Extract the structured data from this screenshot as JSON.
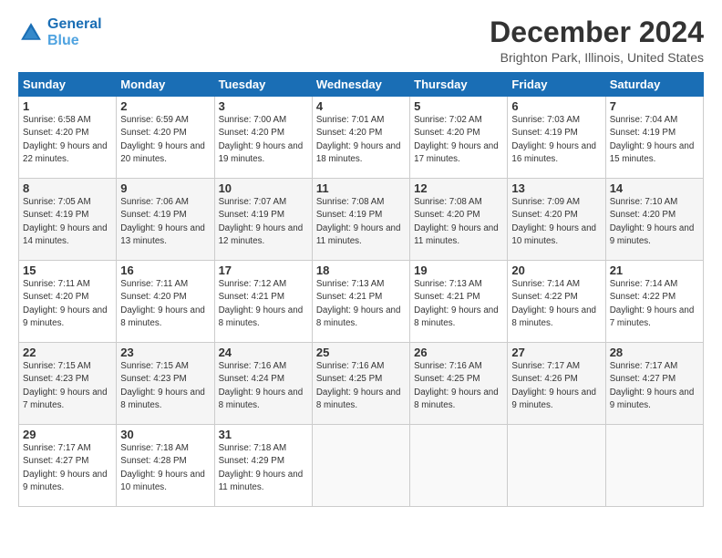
{
  "logo": {
    "line1": "General",
    "line2": "Blue"
  },
  "title": "December 2024",
  "subtitle": "Brighton Park, Illinois, United States",
  "days_header": [
    "Sunday",
    "Monday",
    "Tuesday",
    "Wednesday",
    "Thursday",
    "Friday",
    "Saturday"
  ],
  "weeks": [
    [
      {
        "day": "1",
        "sunrise": "6:58 AM",
        "sunset": "4:20 PM",
        "daylight": "9 hours and 22 minutes."
      },
      {
        "day": "2",
        "sunrise": "6:59 AM",
        "sunset": "4:20 PM",
        "daylight": "9 hours and 20 minutes."
      },
      {
        "day": "3",
        "sunrise": "7:00 AM",
        "sunset": "4:20 PM",
        "daylight": "9 hours and 19 minutes."
      },
      {
        "day": "4",
        "sunrise": "7:01 AM",
        "sunset": "4:20 PM",
        "daylight": "9 hours and 18 minutes."
      },
      {
        "day": "5",
        "sunrise": "7:02 AM",
        "sunset": "4:20 PM",
        "daylight": "9 hours and 17 minutes."
      },
      {
        "day": "6",
        "sunrise": "7:03 AM",
        "sunset": "4:19 PM",
        "daylight": "9 hours and 16 minutes."
      },
      {
        "day": "7",
        "sunrise": "7:04 AM",
        "sunset": "4:19 PM",
        "daylight": "9 hours and 15 minutes."
      }
    ],
    [
      {
        "day": "8",
        "sunrise": "7:05 AM",
        "sunset": "4:19 PM",
        "daylight": "9 hours and 14 minutes."
      },
      {
        "day": "9",
        "sunrise": "7:06 AM",
        "sunset": "4:19 PM",
        "daylight": "9 hours and 13 minutes."
      },
      {
        "day": "10",
        "sunrise": "7:07 AM",
        "sunset": "4:19 PM",
        "daylight": "9 hours and 12 minutes."
      },
      {
        "day": "11",
        "sunrise": "7:08 AM",
        "sunset": "4:19 PM",
        "daylight": "9 hours and 11 minutes."
      },
      {
        "day": "12",
        "sunrise": "7:08 AM",
        "sunset": "4:20 PM",
        "daylight": "9 hours and 11 minutes."
      },
      {
        "day": "13",
        "sunrise": "7:09 AM",
        "sunset": "4:20 PM",
        "daylight": "9 hours and 10 minutes."
      },
      {
        "day": "14",
        "sunrise": "7:10 AM",
        "sunset": "4:20 PM",
        "daylight": "9 hours and 9 minutes."
      }
    ],
    [
      {
        "day": "15",
        "sunrise": "7:11 AM",
        "sunset": "4:20 PM",
        "daylight": "9 hours and 9 minutes."
      },
      {
        "day": "16",
        "sunrise": "7:11 AM",
        "sunset": "4:20 PM",
        "daylight": "9 hours and 8 minutes."
      },
      {
        "day": "17",
        "sunrise": "7:12 AM",
        "sunset": "4:21 PM",
        "daylight": "9 hours and 8 minutes."
      },
      {
        "day": "18",
        "sunrise": "7:13 AM",
        "sunset": "4:21 PM",
        "daylight": "9 hours and 8 minutes."
      },
      {
        "day": "19",
        "sunrise": "7:13 AM",
        "sunset": "4:21 PM",
        "daylight": "9 hours and 8 minutes."
      },
      {
        "day": "20",
        "sunrise": "7:14 AM",
        "sunset": "4:22 PM",
        "daylight": "9 hours and 8 minutes."
      },
      {
        "day": "21",
        "sunrise": "7:14 AM",
        "sunset": "4:22 PM",
        "daylight": "9 hours and 7 minutes."
      }
    ],
    [
      {
        "day": "22",
        "sunrise": "7:15 AM",
        "sunset": "4:23 PM",
        "daylight": "9 hours and 7 minutes."
      },
      {
        "day": "23",
        "sunrise": "7:15 AM",
        "sunset": "4:23 PM",
        "daylight": "9 hours and 8 minutes."
      },
      {
        "day": "24",
        "sunrise": "7:16 AM",
        "sunset": "4:24 PM",
        "daylight": "9 hours and 8 minutes."
      },
      {
        "day": "25",
        "sunrise": "7:16 AM",
        "sunset": "4:25 PM",
        "daylight": "9 hours and 8 minutes."
      },
      {
        "day": "26",
        "sunrise": "7:16 AM",
        "sunset": "4:25 PM",
        "daylight": "9 hours and 8 minutes."
      },
      {
        "day": "27",
        "sunrise": "7:17 AM",
        "sunset": "4:26 PM",
        "daylight": "9 hours and 9 minutes."
      },
      {
        "day": "28",
        "sunrise": "7:17 AM",
        "sunset": "4:27 PM",
        "daylight": "9 hours and 9 minutes."
      }
    ],
    [
      {
        "day": "29",
        "sunrise": "7:17 AM",
        "sunset": "4:27 PM",
        "daylight": "9 hours and 9 minutes."
      },
      {
        "day": "30",
        "sunrise": "7:18 AM",
        "sunset": "4:28 PM",
        "daylight": "9 hours and 10 minutes."
      },
      {
        "day": "31",
        "sunrise": "7:18 AM",
        "sunset": "4:29 PM",
        "daylight": "9 hours and 11 minutes."
      },
      null,
      null,
      null,
      null
    ]
  ]
}
